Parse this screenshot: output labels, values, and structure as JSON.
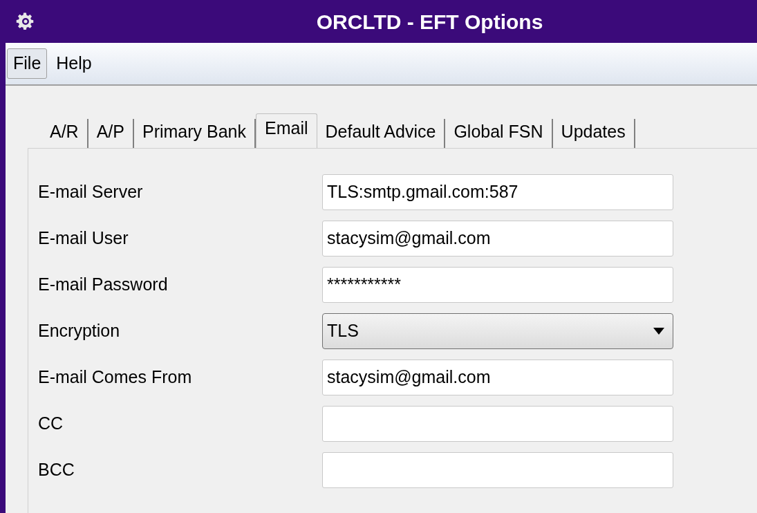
{
  "window": {
    "title": "ORCLTD - EFT Options"
  },
  "menu": [
    {
      "label": "File",
      "selected": true
    },
    {
      "label": "Help",
      "selected": false
    }
  ],
  "tabs": [
    {
      "label": "A/R",
      "selected": false
    },
    {
      "label": "A/P",
      "selected": false
    },
    {
      "label": "Primary Bank",
      "selected": false
    },
    {
      "label": "Email",
      "selected": true
    },
    {
      "label": "Default Advice",
      "selected": false
    },
    {
      "label": "Global FSN",
      "selected": false
    },
    {
      "label": "Updates",
      "selected": false
    }
  ],
  "fields": [
    {
      "kind": "text",
      "label": "E-mail Server",
      "value": "TLS:smtp.gmail.com:587"
    },
    {
      "kind": "text",
      "label": "E-mail User",
      "value": "stacysim@gmail.com"
    },
    {
      "kind": "text",
      "label": "E-mail Password",
      "value": "***********"
    },
    {
      "kind": "select",
      "label": "Encryption",
      "value": "TLS"
    },
    {
      "kind": "text",
      "label": "E-mail Comes From",
      "value": "stacysim@gmail.com"
    },
    {
      "kind": "text",
      "label": "CC"
    },
    {
      "kind": "text",
      "label": "BCC"
    }
  ]
}
